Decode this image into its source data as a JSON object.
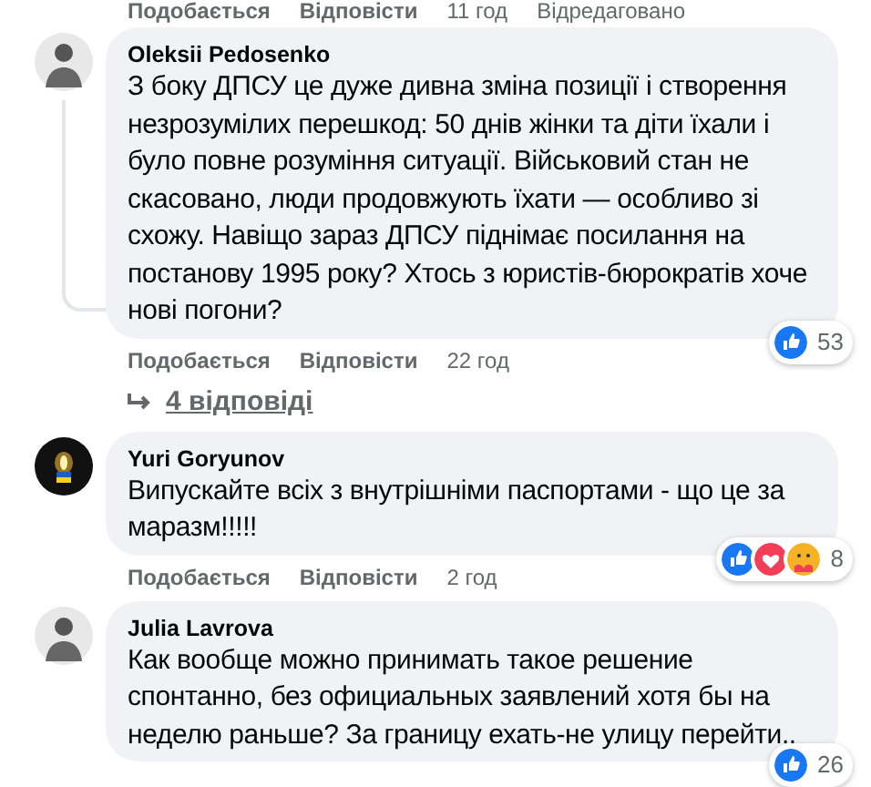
{
  "top_actions": {
    "like": "Подобається",
    "reply": "Відповісти",
    "time": "11 год",
    "edited": "Відредаговано"
  },
  "comments": [
    {
      "author": "Oleksii Pedosenko",
      "text": "З боку ДПСУ це дуже дивна зміна позиції і створення незрозумілих перешкод: 50 днів жінки та діти їхали і було повне розуміння ситуації. Військовий стан не скасовано, люди продовжують їхати — особливо зі схожу. Навіщо зараз ДПСУ піднімає посилання на постанову 1995 року? Хтось з юристів-бюрократів хоче нові погони?",
      "reactions": [
        {
          "kind": "like"
        }
      ],
      "reaction_count": "53",
      "like": "Подобається",
      "reply": "Відповісти",
      "time": "22 год",
      "replies": "4 відповіді",
      "avatar": {
        "kind": "figure"
      }
    },
    {
      "author": "Yuri Goryunov",
      "text": "Випускайте всіх з внутрішніми паспортами - що це за маразм!!!!!",
      "reactions": [
        {
          "kind": "like"
        },
        {
          "kind": "love"
        },
        {
          "kind": "care"
        }
      ],
      "reaction_count": "8",
      "like": "Подобається",
      "reply": "Відповісти",
      "time": "2 год",
      "avatar": {
        "kind": "candle"
      }
    },
    {
      "author": "Julia Lavrova",
      "text": "Как вообще можно принимать такое решение спонтанно, без официальных заявлений хотя бы на неделю раньше? За границу ехать-не улицу перейти..",
      "reactions": [
        {
          "kind": "like"
        }
      ],
      "reaction_count": "26",
      "avatar": {
        "kind": "figure"
      }
    }
  ]
}
